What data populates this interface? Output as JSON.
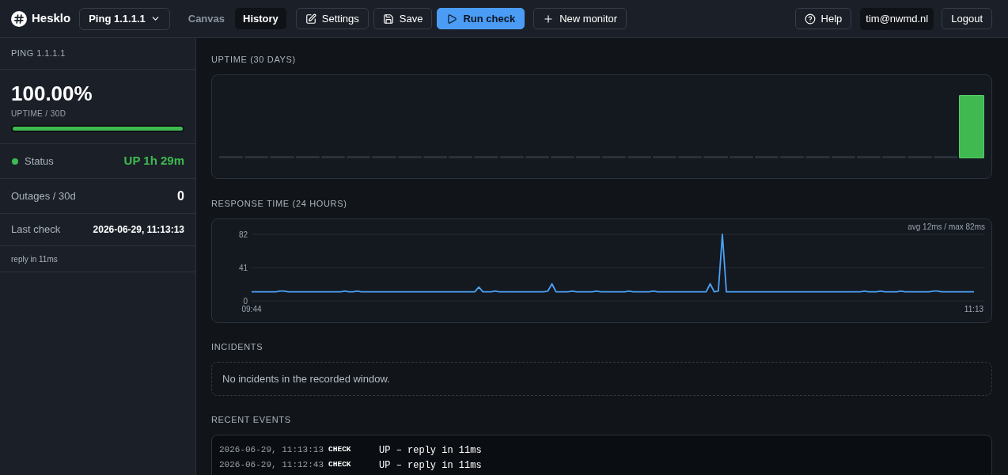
{
  "app": {
    "name": "Hesklo"
  },
  "monitor_select": {
    "value": "Ping 1.1.1.1"
  },
  "tabs": [
    {
      "label": "Canvas",
      "selected": false
    },
    {
      "label": "History",
      "selected": true
    }
  ],
  "toolbar": [
    {
      "label": "Settings",
      "kind": "settings"
    },
    {
      "label": "Save",
      "kind": "save"
    },
    {
      "label": "Run check",
      "kind": "run"
    },
    {
      "label": "New monitor",
      "kind": "add"
    }
  ],
  "header_right": {
    "help": "Help",
    "user": "tim@nwmd.nl",
    "logout": "Logout"
  },
  "sidebar": {
    "title": "PING 1.1.1.1",
    "uptime": {
      "value": "100.00%",
      "caption": "UPTIME / 30D",
      "level": 1
    },
    "status": {
      "label": "Status",
      "value": "UP 1h 29m",
      "color": "#3fb950"
    },
    "stats": [
      {
        "label": "Outages / 30d",
        "value": "0",
        "kind": "count"
      },
      {
        "label": "Last check",
        "value": "2026-06-29, 11:13:13",
        "kind": "time"
      }
    ],
    "note": "reply in 11ms"
  },
  "uptime_section": {
    "title": "UPTIME (30 DAYS)",
    "days": [
      {
        "kind": "none"
      },
      {
        "kind": "none"
      },
      {
        "kind": "none"
      },
      {
        "kind": "none"
      },
      {
        "kind": "none"
      },
      {
        "kind": "none"
      },
      {
        "kind": "none"
      },
      {
        "kind": "none"
      },
      {
        "kind": "none"
      },
      {
        "kind": "none"
      },
      {
        "kind": "none"
      },
      {
        "kind": "none"
      },
      {
        "kind": "none"
      },
      {
        "kind": "none"
      },
      {
        "kind": "none"
      },
      {
        "kind": "none"
      },
      {
        "kind": "none"
      },
      {
        "kind": "none"
      },
      {
        "kind": "none"
      },
      {
        "kind": "none"
      },
      {
        "kind": "none"
      },
      {
        "kind": "none"
      },
      {
        "kind": "none"
      },
      {
        "kind": "none"
      },
      {
        "kind": "none"
      },
      {
        "kind": "none"
      },
      {
        "kind": "none"
      },
      {
        "kind": "none"
      },
      {
        "kind": "none"
      },
      {
        "kind": "up"
      }
    ]
  },
  "response_section": {
    "title": "RESPONSE TIME (24 HOURS)",
    "summary": "avg 12ms / max 82ms",
    "chart_data": {
      "type": "line",
      "categories": [
        "09:44",
        null,
        null,
        null,
        null,
        null,
        null,
        null,
        null,
        null,
        null,
        null,
        null,
        null,
        null,
        null,
        null,
        null,
        null,
        null,
        null,
        null,
        null,
        null,
        null,
        null,
        null,
        null,
        null,
        null,
        null,
        null,
        null,
        null,
        null,
        null,
        null,
        null,
        null,
        null,
        null,
        null,
        null,
        null,
        null,
        null,
        null,
        null,
        null,
        null,
        null,
        null,
        null,
        null,
        null,
        null,
        null,
        null,
        null,
        null,
        null,
        null,
        null,
        null,
        null,
        null,
        null,
        null,
        null,
        null,
        null,
        null,
        null,
        null,
        null,
        null,
        null,
        null,
        null,
        null,
        null,
        null,
        null,
        null,
        null,
        null,
        null,
        null,
        null,
        null,
        null,
        null,
        null,
        null,
        null,
        null,
        null,
        null,
        null,
        null,
        null,
        null,
        null,
        null,
        null,
        null,
        null,
        null,
        null,
        null,
        null,
        null,
        null,
        null,
        null,
        null,
        null,
        null,
        null,
        null,
        null,
        null,
        null,
        null,
        null,
        null,
        null,
        null,
        null,
        null,
        null,
        null,
        null,
        null,
        null,
        null,
        null,
        null,
        null,
        null,
        null,
        null,
        null,
        null,
        null,
        null,
        null,
        null,
        null,
        null,
        null,
        null,
        null,
        null,
        null,
        null,
        null,
        null,
        null,
        null,
        null,
        null,
        null,
        null,
        null,
        null,
        null,
        null,
        null,
        null,
        null,
        null,
        null,
        null,
        null,
        null,
        null,
        null,
        "11:13"
      ],
      "values": [
        11,
        11,
        11,
        11,
        11,
        11,
        11,
        12,
        12,
        11,
        11,
        11,
        11,
        11,
        11,
        11,
        11,
        11,
        11,
        11,
        11,
        11,
        11,
        12,
        11,
        11,
        12,
        11,
        11,
        11,
        11,
        11,
        11,
        11,
        11,
        11,
        11,
        11,
        11,
        11,
        11,
        11,
        11,
        11,
        11,
        11,
        11,
        11,
        11,
        11,
        11,
        11,
        11,
        11,
        11,
        11,
        17,
        11,
        11,
        11,
        12,
        11,
        11,
        11,
        11,
        11,
        11,
        11,
        11,
        11,
        11,
        11,
        11,
        12,
        21,
        11,
        11,
        11,
        11,
        12,
        11,
        11,
        11,
        11,
        11,
        12,
        11,
        11,
        11,
        11,
        11,
        11,
        11,
        12,
        11,
        11,
        11,
        11,
        11,
        12,
        11,
        11,
        11,
        11,
        11,
        11,
        11,
        11,
        11,
        11,
        11,
        11,
        11,
        21,
        11,
        12,
        82,
        11,
        11,
        11,
        11,
        11,
        11,
        11,
        11,
        11,
        11,
        11,
        11,
        11,
        11,
        11,
        11,
        11,
        11,
        11,
        11,
        11,
        11,
        11,
        11,
        11,
        11,
        11,
        11,
        11,
        11,
        11,
        11,
        11,
        11,
        12,
        11,
        11,
        11,
        12,
        11,
        11,
        11,
        11,
        12,
        11,
        11,
        11,
        11,
        11,
        11,
        11,
        12,
        12,
        11,
        11,
        11,
        11,
        11,
        11,
        11,
        11,
        11
      ],
      "ylim": [
        0,
        82
      ],
      "yticks": [
        0,
        41,
        82
      ]
    }
  },
  "incidents": {
    "title": "INCIDENTS",
    "empty_text": "No incidents in the recorded window."
  },
  "events": {
    "title": "RECENT EVENTS",
    "rows": [
      {
        "time": "2026-06-29, 11:13:13",
        "type": "CHECK",
        "message": "UP – reply in 11ms"
      },
      {
        "time": "2026-06-29, 11:12:43",
        "type": "CHECK",
        "message": "UP – reply in 11ms"
      }
    ]
  }
}
